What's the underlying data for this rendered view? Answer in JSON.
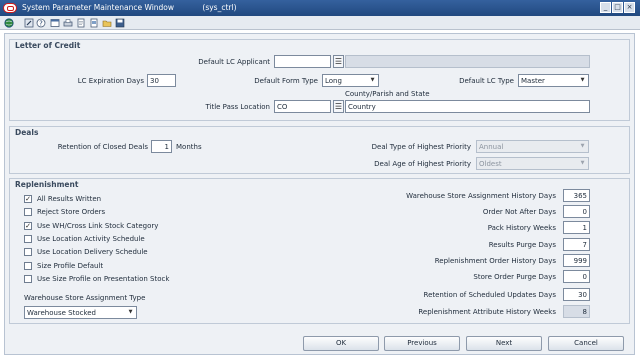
{
  "window": {
    "title": "System Parameter Maintenance Window",
    "subtitle": "(sys_ctrl)",
    "controls": {
      "minimize": "_",
      "maximize": "□",
      "close": "×"
    }
  },
  "toolbar": {
    "icons": [
      "globe-icon",
      "wrench-icon",
      "help-icon",
      "window-icon",
      "printer-icon",
      "page-icon",
      "document-icon",
      "folder-icon",
      "save-icon"
    ]
  },
  "letter_of_credit": {
    "title": "Letter of Credit",
    "default_lc_applicant_label": "Default LC Applicant",
    "default_lc_applicant_value": "",
    "default_lc_applicant_desc": "",
    "lc_expiration_days_label": "LC Expiration Days",
    "lc_expiration_days_value": "30",
    "default_form_type_label": "Default Form Type",
    "default_form_type_value": "Long",
    "default_lc_type_label": "Default LC Type",
    "default_lc_type_value": "Master",
    "county_parish_state_label": "County/Parish and State",
    "title_pass_location_label": "Title Pass Location",
    "title_pass_location_value": "CO",
    "title_pass_location_desc": "Country"
  },
  "deals": {
    "title": "Deals",
    "retention_label": "Retention of Closed Deals",
    "retention_value": "1",
    "months_label": "Months",
    "type_priority_label": "Deal Type of Highest Priority",
    "type_priority_value": "Annual",
    "age_priority_label": "Deal Age of Highest Priority",
    "age_priority_value": "Oldest"
  },
  "replenishment": {
    "title": "Replenishment",
    "checkboxes": [
      {
        "label": "All Results Written",
        "checked": true
      },
      {
        "label": "Reject Store Orders",
        "checked": false
      },
      {
        "label": "Use WH/Cross Link Stock Category",
        "checked": true
      },
      {
        "label": "Use Location Activity Schedule",
        "checked": false
      },
      {
        "label": "Use Location Delivery Schedule",
        "checked": false
      },
      {
        "label": "Size Profile Default",
        "checked": false
      },
      {
        "label": "Use Size Profile on Presentation Stock",
        "checked": false
      }
    ],
    "wh_assignment_type_label": "Warehouse Store Assignment Type",
    "wh_assignment_type_value": "Warehouse Stocked",
    "fields": [
      {
        "label": "Warehouse Store Assignment History Days",
        "value": "365",
        "readonly": false
      },
      {
        "label": "Order Not After Days",
        "value": "0",
        "readonly": false
      },
      {
        "label": "Pack History Weeks",
        "value": "1",
        "readonly": false
      },
      {
        "label": "Results Purge Days",
        "value": "7",
        "readonly": false
      },
      {
        "label": "Replenishment Order History Days",
        "value": "999",
        "readonly": false
      },
      {
        "label": "Store Order Purge Days",
        "value": "0",
        "readonly": false
      },
      {
        "label": "Retention of Scheduled Updates Days",
        "value": "30",
        "readonly": false
      },
      {
        "label": "Replenishment Attribute History Weeks",
        "value": "8",
        "readonly": true
      }
    ]
  },
  "buttons": {
    "ok": "OK",
    "previous": "Previous",
    "next": "Next",
    "cancel": "Cancel"
  },
  "colors": {
    "titlebar": "#2b5590",
    "panel": "#eef1f5",
    "accent_red": "#d21b1b"
  }
}
